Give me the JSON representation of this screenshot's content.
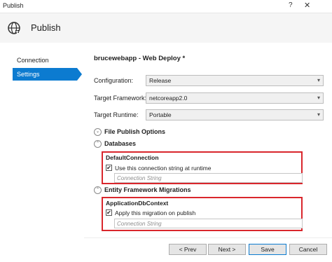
{
  "window": {
    "title": "Publish",
    "help_glyph": "?",
    "close_glyph": "✕"
  },
  "header": {
    "title": "Publish",
    "icon": "globe-icon"
  },
  "sidebar": {
    "items": [
      {
        "label": "Connection"
      },
      {
        "label": "Settings",
        "selected": true
      }
    ]
  },
  "main": {
    "profile_title": "brucewebapp - Web Deploy *",
    "settings": [
      {
        "label": "Configuration:",
        "value": "Release"
      },
      {
        "label": "Target Framework:",
        "value": "netcoreapp2.0"
      },
      {
        "label": "Target Runtime:",
        "value": "Portable"
      }
    ],
    "sections": {
      "file_publish": {
        "label": "File Publish Options",
        "expanded": false
      },
      "databases": {
        "label": "Databases",
        "expanded": true
      },
      "ef_migrations": {
        "label": "Entity Framework Migrations",
        "expanded": true
      }
    },
    "databases": {
      "name": "DefaultConnection",
      "checkbox_label": "Use this connection string at runtime",
      "checked": true,
      "placeholder": "Connection String",
      "value": ""
    },
    "migrations": {
      "name": "ApplicationDbContext",
      "checkbox_label": "Apply this migration on publish",
      "checked": true,
      "placeholder": "Connection String",
      "value": ""
    }
  },
  "footer": {
    "prev_label": "< Prev",
    "next_label": "Next >",
    "save_label": "Save",
    "cancel_label": "Cancel"
  },
  "colors": {
    "accent": "#0c7bd0",
    "highlight_box": "#d9262c"
  },
  "glyphs": {
    "dropdown_arrow": "▾",
    "check": "✔",
    "chevron_down": "⌄",
    "chevron_up": "⌃"
  }
}
